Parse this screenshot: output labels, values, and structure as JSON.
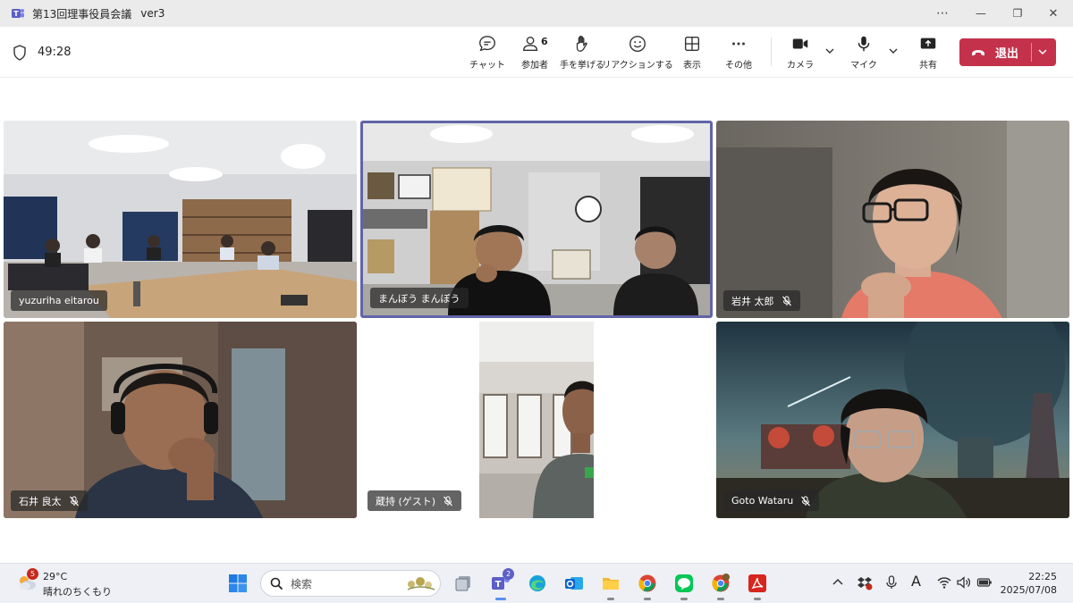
{
  "window": {
    "title": "第13回理事役員会議",
    "version": "ver3",
    "controls": {
      "more": "⋯",
      "minimize": "—",
      "restore": "❐",
      "close": "✕"
    }
  },
  "toolbar": {
    "timer": "49:28",
    "participant_count": "6",
    "buttons": {
      "chat": "チャット",
      "people": "参加者",
      "raise_hand": "手を挙げる",
      "react": "リアクションする",
      "view": "表示",
      "more": "その他",
      "camera": "カメラ",
      "mic": "マイク",
      "share": "共有",
      "leave": "退出"
    }
  },
  "participants": [
    {
      "name": "yuzuriha eitarou",
      "muted": false,
      "active_speaker": false
    },
    {
      "name": "まんぼう まんぼう",
      "muted": false,
      "active_speaker": true
    },
    {
      "name": "岩井 太郎",
      "muted": true,
      "active_speaker": false
    },
    {
      "name": "石井 良太",
      "muted": true,
      "active_speaker": false
    },
    {
      "name": "蔵持 (ゲスト)",
      "muted": true,
      "active_speaker": false
    },
    {
      "name": "Goto Wataru",
      "muted": true,
      "active_speaker": false
    }
  ],
  "taskbar": {
    "weather": {
      "temp": "29°C",
      "desc": "晴れのちくもり",
      "badge": "5"
    },
    "search_placeholder": "検索",
    "teams_badge": "2",
    "clock": {
      "time": "22:25",
      "date": "2025/07/08"
    },
    "ime": "A",
    "icons": [
      "windows-start",
      "search",
      "task-view",
      "teams",
      "edge",
      "outlook",
      "file-explorer",
      "chrome",
      "line",
      "chrome-canary",
      "acrobat"
    ]
  },
  "colors": {
    "leave": "#c4314b",
    "active_speaker_border": "#6264a7",
    "titlebar": "#ebebeb",
    "taskbar": "#eef0f5"
  }
}
